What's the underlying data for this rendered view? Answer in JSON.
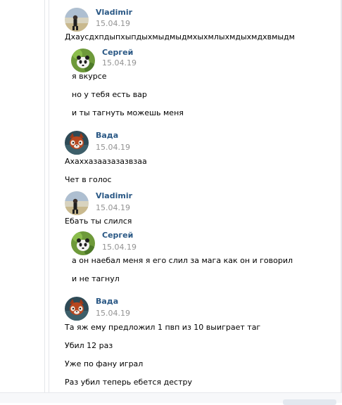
{
  "colors": {
    "author": "#2a5885",
    "time": "#939393",
    "rail": "#e4e6ea"
  },
  "messages": [
    {
      "author": "Vladimir",
      "time": "15.04.19",
      "avatar": "vladimir-avatar-icon",
      "lines": [
        "Дхаусдхпдыпхыпдыхмыдмыдмхыхмлыхмдыхмдхвмыдм"
      ]
    },
    {
      "author": "Сергей",
      "time": "15.04.19",
      "avatar": "panda-avatar-icon",
      "lines": [
        "я вкурсе",
        "но у тебя есть вар",
        "и ты тагнуть можешь меня"
      ]
    },
    {
      "author": "Вада",
      "time": "15.04.19",
      "avatar": "red-panda-avatar-icon",
      "lines": [
        "Ахаххазаазазазвзаа",
        "Чет в голос"
      ]
    },
    {
      "author": "Vladimir",
      "time": "15.04.19",
      "avatar": "vladimir-avatar-icon",
      "lines": [
        "Ебать ты слился"
      ]
    },
    {
      "author": "Сергей",
      "time": "15.04.19",
      "avatar": "panda-avatar-icon",
      "lines": [
        "а он наебал меня я его слил за мага как он и говорил",
        "и не тагнул"
      ]
    },
    {
      "author": "Вада",
      "time": "15.04.19",
      "avatar": "red-panda-avatar-icon",
      "lines": [
        "Та яж ему предложил 1 пвп из 10 выиграет таг",
        "Убил 12 раз",
        "Уже по фану играл",
        "Раз убил теперь ебется дестру"
      ]
    }
  ]
}
